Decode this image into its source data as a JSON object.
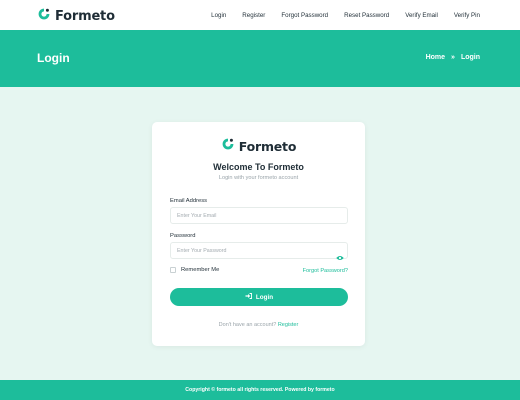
{
  "brand": {
    "name": "Formeto",
    "accent": "#1dbd9b"
  },
  "nav": {
    "items": [
      "Login",
      "Register",
      "Forgot Password",
      "Reset Password",
      "Verify Email",
      "Verify Pin"
    ]
  },
  "banner": {
    "title": "Login",
    "breadcrumb": {
      "home": "Home",
      "separator": "»",
      "current": "Login"
    }
  },
  "card": {
    "brand": "Formeto",
    "welcome": "Welcome To Formeto",
    "subtitle": "Login with your formeto account",
    "email": {
      "label": "Email Address",
      "placeholder": "Enter Your Email",
      "value": ""
    },
    "password": {
      "label": "Password",
      "placeholder": "Enter Your Password",
      "value": "",
      "toggle_icon": "eye-icon"
    },
    "remember_label": "Remember Me",
    "forgot_link": "Forgot Password?",
    "login_button": "Login",
    "login_icon": "sign-in-icon",
    "signup_text": "Don't have an account?",
    "signup_link": "Register"
  },
  "footer": {
    "text": "Copyright © formeto all rights reserved. Powered by formeto"
  }
}
